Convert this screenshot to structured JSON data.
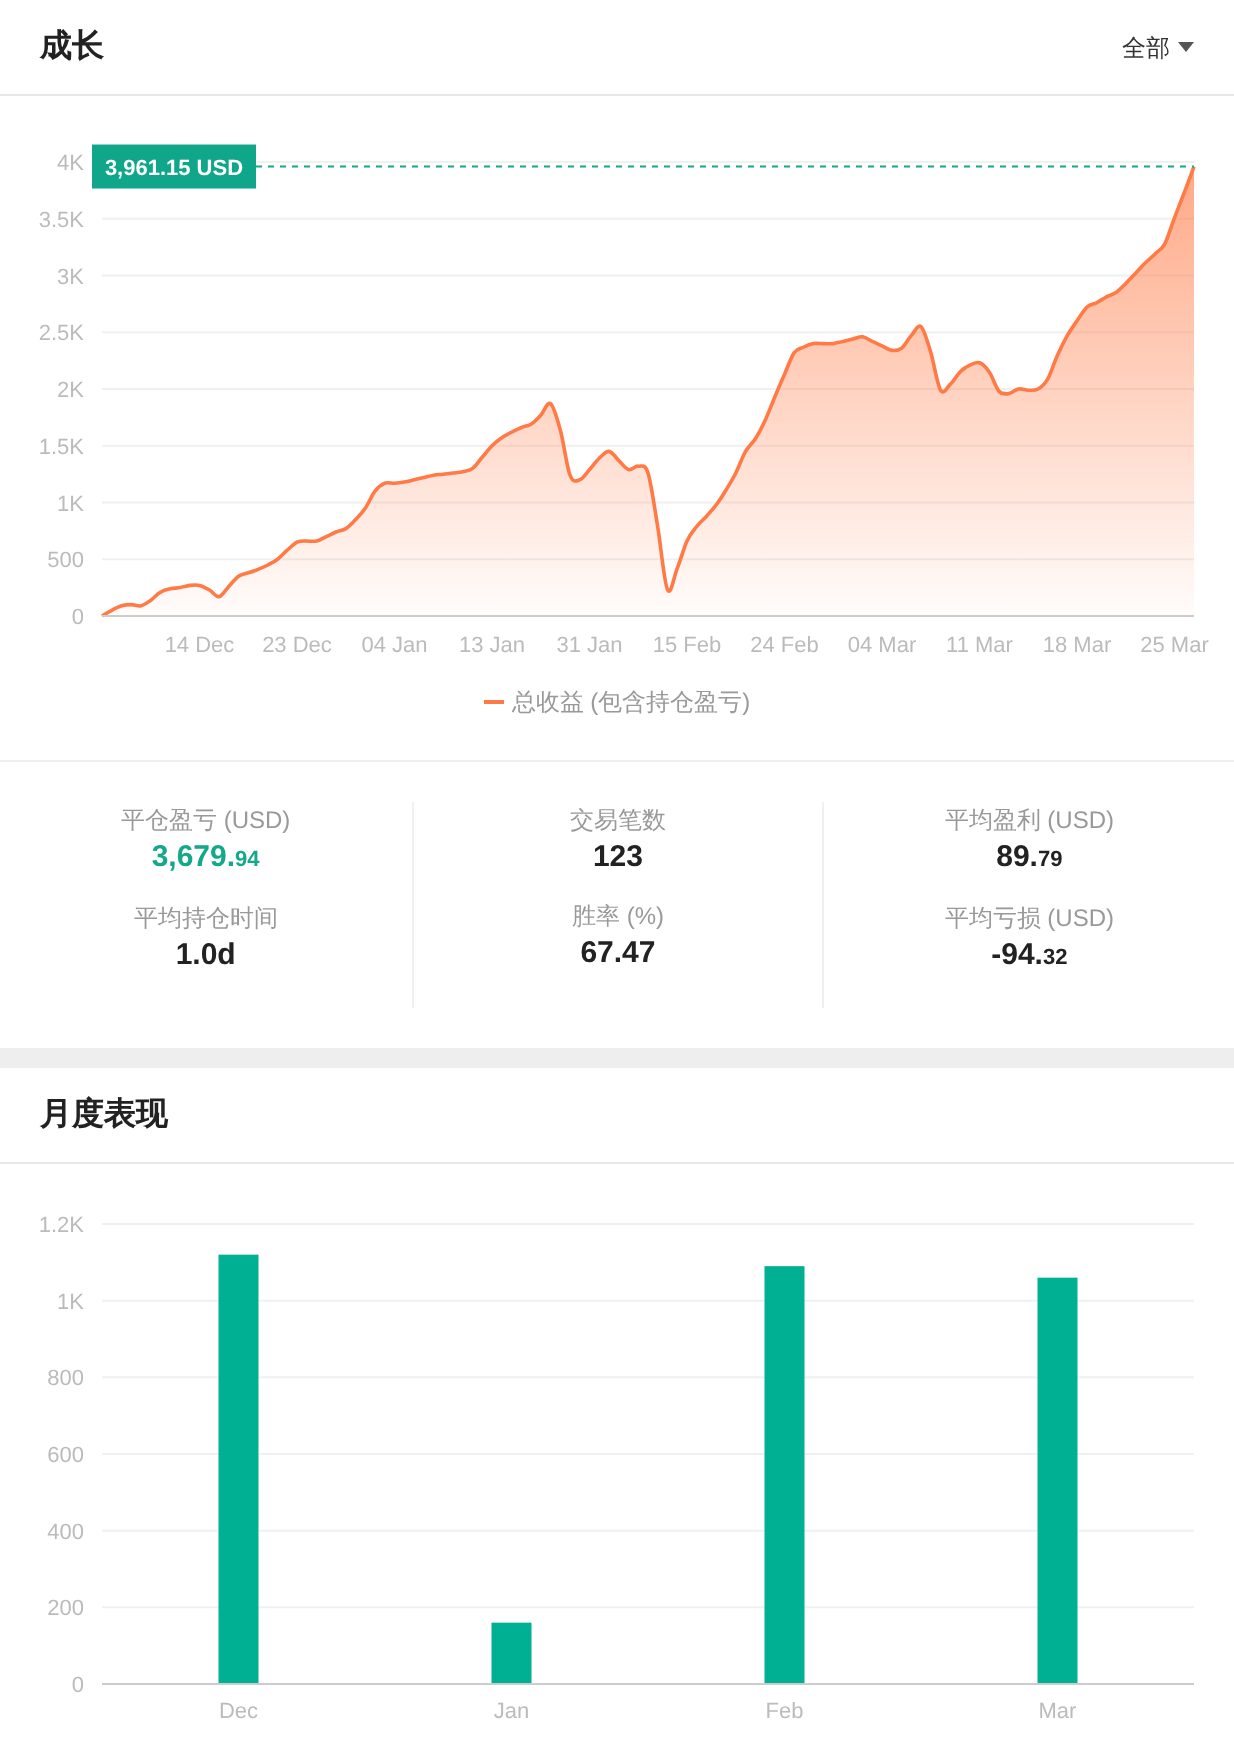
{
  "growth": {
    "title": "成长",
    "filter": {
      "label": "全部"
    },
    "chart_data": {
      "type": "area",
      "grid": true,
      "ylim": [
        0,
        4000
      ],
      "yticks": [
        {
          "value": 0,
          "label": "0"
        },
        {
          "value": 500,
          "label": "500"
        },
        {
          "value": 1000,
          "label": "1K"
        },
        {
          "value": 1500,
          "label": "1.5K"
        },
        {
          "value": 2000,
          "label": "2K"
        },
        {
          "value": 2500,
          "label": "2.5K"
        },
        {
          "value": 3000,
          "label": "3K"
        },
        {
          "value": 3500,
          "label": "3.5K"
        },
        {
          "value": 4000,
          "label": "4K"
        }
      ],
      "categories": [
        null,
        null,
        null,
        null,
        null,
        null,
        null,
        null,
        null,
        null,
        "14 Dec",
        null,
        null,
        null,
        null,
        null,
        null,
        null,
        null,
        null,
        "23 Dec",
        null,
        null,
        null,
        null,
        null,
        null,
        null,
        null,
        null,
        "04 Jan",
        null,
        null,
        null,
        null,
        null,
        null,
        null,
        null,
        null,
        "13 Jan",
        null,
        null,
        null,
        null,
        null,
        null,
        null,
        null,
        null,
        "31 Jan",
        null,
        null,
        null,
        null,
        null,
        null,
        null,
        null,
        null,
        "15 Feb",
        null,
        null,
        null,
        null,
        null,
        null,
        null,
        null,
        null,
        "24 Feb",
        null,
        null,
        null,
        null,
        null,
        null,
        null,
        null,
        null,
        "04 Mar",
        null,
        null,
        null,
        null,
        null,
        null,
        null,
        null,
        null,
        "11 Mar",
        null,
        null,
        null,
        null,
        null,
        null,
        null,
        null,
        null,
        "18 Mar",
        null,
        null,
        null,
        null,
        null,
        null,
        null,
        null,
        null,
        "25 Mar",
        null,
        null
      ],
      "series": [
        {
          "name": "总收益 (包含持仓盈亏)",
          "color": "#ff7a45",
          "values": [
            0,
            50,
            90,
            100,
            90,
            140,
            210,
            240,
            250,
            270,
            270,
            230,
            170,
            260,
            350,
            380,
            410,
            450,
            500,
            580,
            650,
            660,
            660,
            700,
            740,
            770,
            850,
            950,
            1100,
            1170,
            1170,
            1180,
            1200,
            1220,
            1240,
            1250,
            1260,
            1270,
            1300,
            1400,
            1500,
            1570,
            1620,
            1660,
            1690,
            1770,
            1870,
            1640,
            1240,
            1200,
            1290,
            1390,
            1450,
            1370,
            1290,
            1320,
            1260,
            780,
            230,
            420,
            660,
            790,
            880,
            980,
            1110,
            1260,
            1450,
            1560,
            1720,
            1930,
            2130,
            2320,
            2370,
            2400,
            2400,
            2400,
            2420,
            2440,
            2460,
            2420,
            2380,
            2340,
            2360,
            2470,
            2550,
            2320,
            1990,
            2040,
            2150,
            2210,
            2230,
            2150,
            1980,
            1960,
            2000,
            1990,
            2000,
            2090,
            2300,
            2470,
            2600,
            2720,
            2760,
            2810,
            2850,
            2930,
            3020,
            3110,
            3190,
            3280,
            3510,
            3730,
            3960
          ]
        }
      ],
      "ref_lines": [
        {
          "label": "3,961.15 USD"
        }
      ]
    }
  },
  "stats": [
    {
      "label": "平仓盈亏 (USD)",
      "value_main": "3,679.",
      "value_decimals": "94",
      "color": "#14a88a"
    },
    {
      "label": "交易笔数",
      "value_main": "123",
      "color": "#222222"
    },
    {
      "label": "平均盈利 (USD)",
      "value_main": "89.",
      "value_decimals": "79",
      "color": "#222222"
    },
    {
      "label": "平均持仓时间",
      "value_main": "1.0d",
      "color": "#222222"
    },
    {
      "label": "胜率 (%)",
      "value_main": "67.47",
      "color": "#222222"
    },
    {
      "label": "平均亏损 (USD)",
      "value_main": "-94.",
      "value_decimals": "32",
      "color": "#222222"
    }
  ],
  "monthly": {
    "title": "月度表现",
    "chart_data": {
      "type": "bar",
      "grid": true,
      "categories": [
        "Dec",
        "Jan",
        "Feb",
        "Mar"
      ],
      "ylim": [
        0,
        1200
      ],
      "yticks": [
        {
          "value": 0,
          "label": "0"
        },
        {
          "value": 200,
          "label": "200"
        },
        {
          "value": 400,
          "label": "400"
        },
        {
          "value": 600,
          "label": "600"
        },
        {
          "value": 800,
          "label": "800"
        },
        {
          "value": 1000,
          "label": "1K"
        },
        {
          "value": 1200,
          "label": "1.2K"
        }
      ],
      "series": [
        {
          "color": "#00b092",
          "values": [
            1120,
            160,
            1090,
            1060
          ]
        }
      ]
    }
  }
}
